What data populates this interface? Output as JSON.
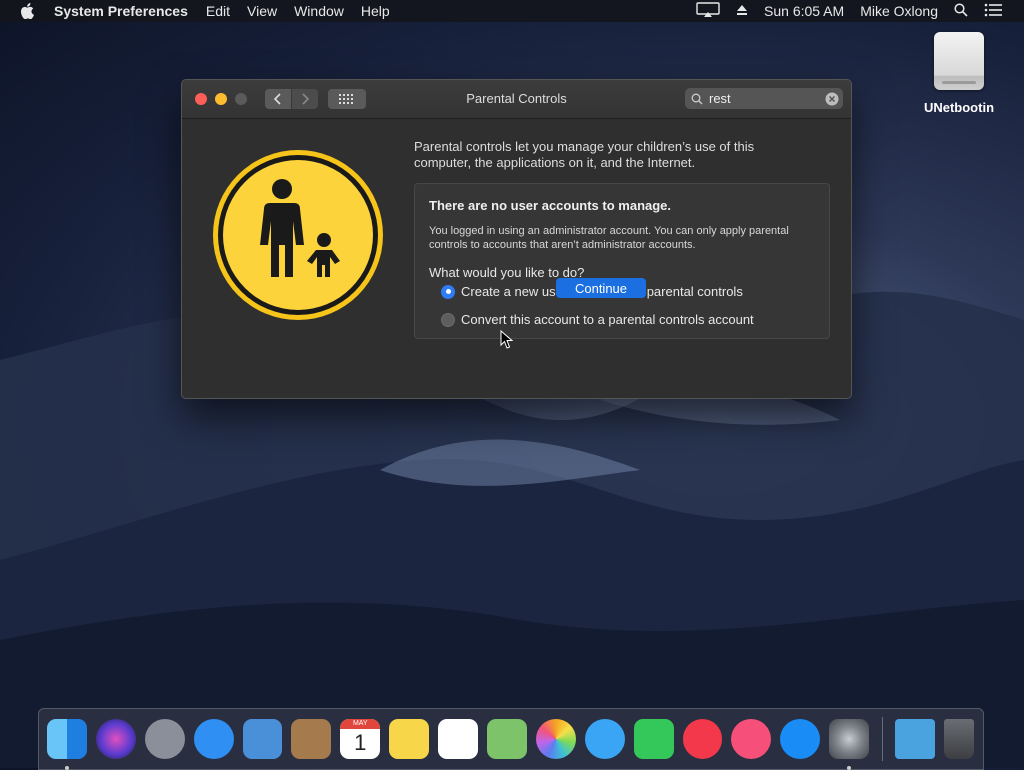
{
  "menubar": {
    "app_name": "System Preferences",
    "menus": [
      "Edit",
      "View",
      "Window",
      "Help"
    ],
    "clock": "Sun 6:05 AM",
    "user": "Mike Oxlong"
  },
  "desktop": {
    "drive_label": "UNetbootin"
  },
  "window": {
    "title": "Parental Controls",
    "search_value": "rest",
    "intro_text": "Parental controls let you manage your children’s use of this computer, the applications on it, and the Internet.",
    "panel": {
      "heading": "There are no user accounts to manage.",
      "description": "You logged in using an administrator account. You can only apply parental controls to accounts that aren’t administrator accounts.",
      "question": "What would you like to do?",
      "options": [
        {
          "label": "Create a new user account with parental controls",
          "selected": true
        },
        {
          "label": "Convert this account to a parental controls account",
          "selected": false
        }
      ]
    },
    "continue_label": "Continue"
  },
  "dock": {
    "items": [
      {
        "name": "finder-icon",
        "color": "#3d9bf0",
        "running": true
      },
      {
        "name": "siri-icon",
        "color": "#6b3fd0",
        "running": false
      },
      {
        "name": "launchpad-icon",
        "color": "#8a8f99",
        "running": false
      },
      {
        "name": "safari-icon",
        "color": "#2f8ff2",
        "running": false
      },
      {
        "name": "mail-icon",
        "color": "#4a90d9",
        "running": false
      },
      {
        "name": "contacts-icon",
        "color": "#a57b4d",
        "running": false
      },
      {
        "name": "calendar-icon",
        "color": "#ffffff",
        "running": false
      },
      {
        "name": "notes-icon",
        "color": "#f7d64a",
        "running": false
      },
      {
        "name": "reminders-icon",
        "color": "#ffffff",
        "running": false
      },
      {
        "name": "maps-icon",
        "color": "#7cc36a",
        "running": false
      },
      {
        "name": "photos-icon",
        "color": "#f5a623",
        "running": false
      },
      {
        "name": "messages-icon",
        "color": "#3aa5f5",
        "running": false
      },
      {
        "name": "facetime-icon",
        "color": "#34c759",
        "running": false
      },
      {
        "name": "news-icon",
        "color": "#f2384a",
        "running": false
      },
      {
        "name": "itunes-icon",
        "color": "#f64f7a",
        "running": false
      },
      {
        "name": "app-store-icon",
        "color": "#1a8cf5",
        "running": false
      },
      {
        "name": "system-preferences-icon",
        "color": "#7a7d84",
        "running": true
      }
    ],
    "calendar_month": "MAY",
    "calendar_day": "1"
  }
}
